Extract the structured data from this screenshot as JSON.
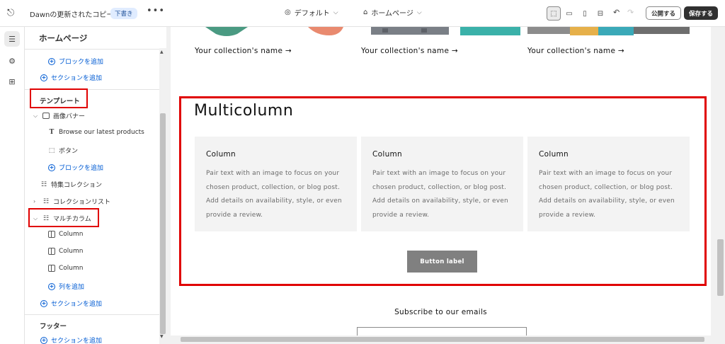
{
  "topbar": {
    "theme_name": "Dawnの更新されたコピー",
    "draft_badge": "下書き",
    "more": "•••",
    "theme_select": "デフォルト",
    "page_select": "ホームページ",
    "publish_label": "公開する",
    "save_label": "保存する"
  },
  "sidebar": {
    "title": "ホームページ",
    "add_block_1": "ブロックを追加",
    "add_section_1": "セクションを追加",
    "template_label": "テンプレート",
    "image_banner": "画像バナー",
    "banner_heading": "Browse our latest products",
    "banner_button": "ボタン",
    "add_block_2": "ブロックを追加",
    "featured_collection": "特集コレクション",
    "collection_list": "コレクションリスト",
    "multicolumn": "マルチカラム",
    "col_1": "Column",
    "col_2": "Column",
    "col_3": "Column",
    "add_column": "列を追加",
    "add_section_2": "セクションを追加",
    "footer_label": "フッター",
    "add_section_3": "セクションを追加"
  },
  "preview": {
    "collection_links": [
      "Your collection's name",
      "Your collection's name",
      "Your collection's name"
    ],
    "multicolumn_title": "Multicolumn",
    "columns": [
      {
        "heading": "Column",
        "text": "Pair text with an image to focus on your chosen product, collection, or blog post. Add details on availability, style, or even provide a review."
      },
      {
        "heading": "Column",
        "text": "Pair text with an image to focus on your chosen product, collection, or blog post. Add details on availability, style, or even provide a review."
      },
      {
        "heading": "Column",
        "text": "Pair text with an image to focus on your chosen product, collection, or blog post. Add details on availability, style, or even provide a review."
      }
    ],
    "button_label": "Button label",
    "subscribe_title": "Subscribe to our emails"
  },
  "colors": {
    "highlight": "#e00000",
    "link_blue": "#005bd3",
    "save_bg": "#303030"
  }
}
